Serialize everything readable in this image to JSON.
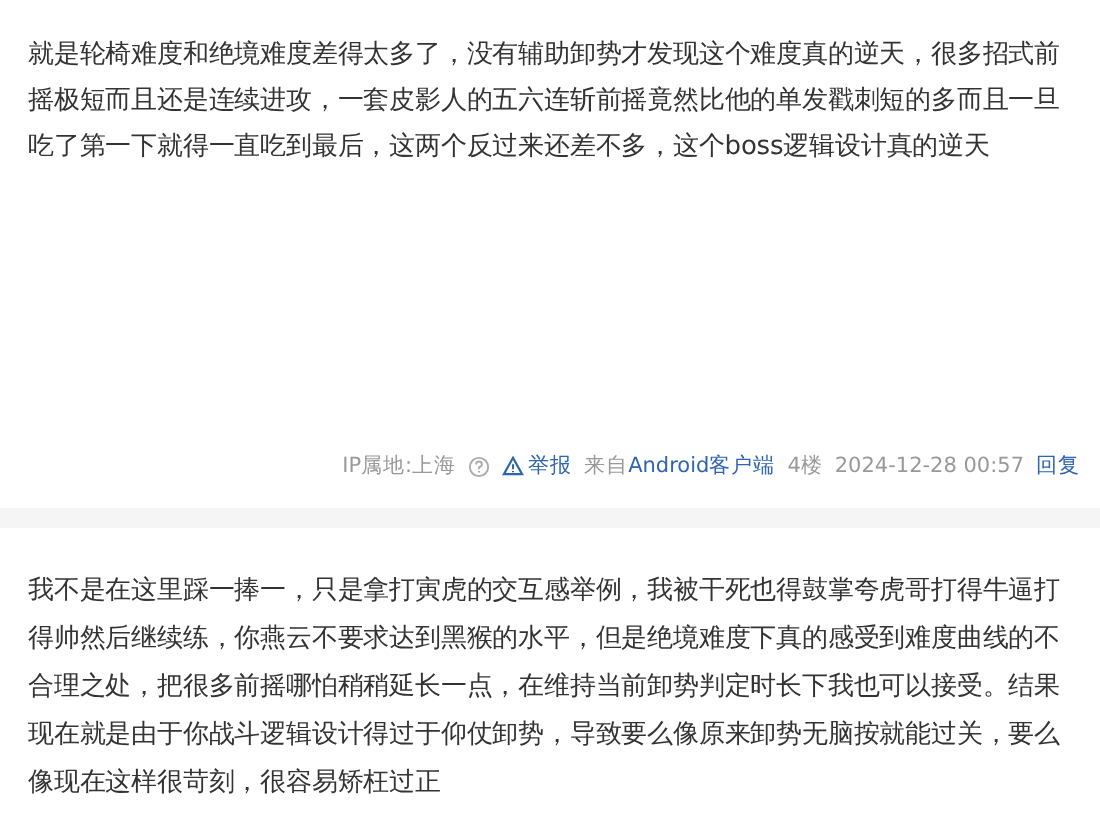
{
  "posts": [
    {
      "text": "就是轮椅难度和绝境难度差得太多了，没有辅助卸势才发现这个难度真的逆天，很多招式前摇极短而且还是连续进攻，一套皮影人的五六连斩前摇竟然比他的单发戳刺短的多而且一旦吃了第一下就得一直吃到最后，这两个反过来还差不多，这个boss逻辑设计真的逆天",
      "meta": {
        "ip": "IP属地:上海",
        "report": "举报",
        "source_prefix": "来自",
        "source": "Android客户端",
        "floor": "4楼",
        "time": "2024-12-28 00:57",
        "reply": "回复"
      }
    },
    {
      "text": "我不是在这里踩一捧一，只是拿打寅虎的交互感举例，我被干死也得鼓掌夸虎哥打得牛逼打得帅然后继续练，你燕云不要求达到黑猴的水平，但是绝境难度下真的感受到难度曲线的不合理之处，把很多前摇哪怕稍稍延长一点，在维持当前卸势判定时长下我也可以接受。结果现在就是由于你战斗逻辑设计得过于仰仗卸势，导致要么像原来卸势无脑按就能过关，要么像现在这样很苛刻，很容易矫枉过正"
    }
  ]
}
